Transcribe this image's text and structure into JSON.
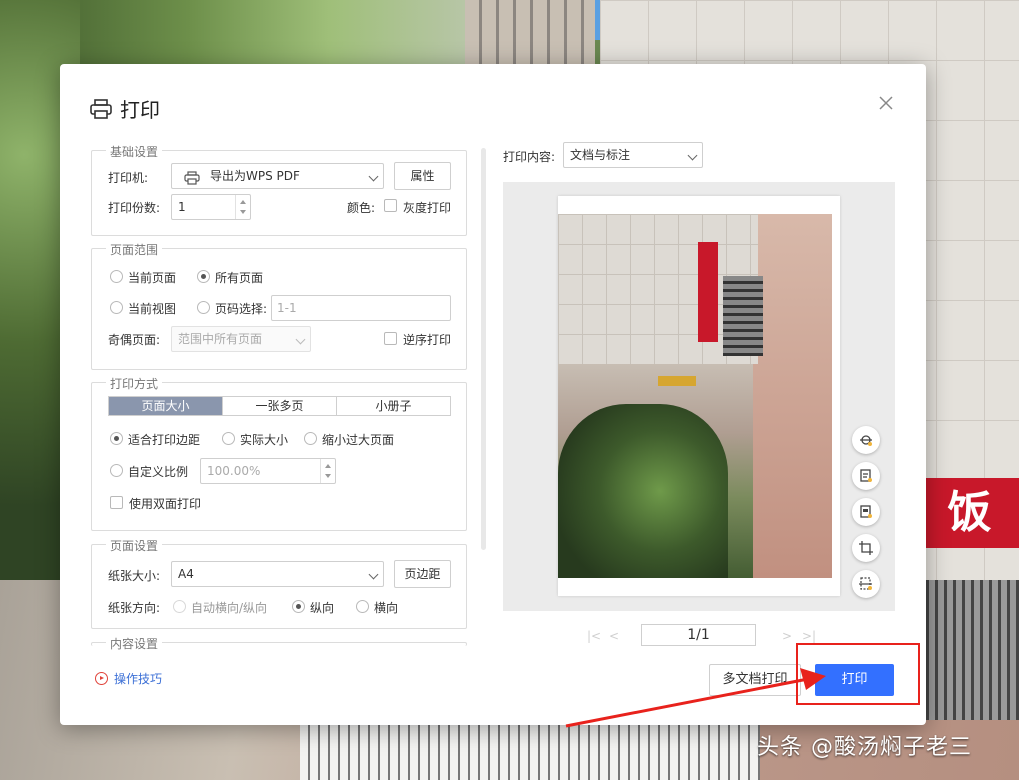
{
  "dialog": {
    "title": "打印",
    "basic": {
      "legend": "基础设置",
      "printer_label": "打印机:",
      "printer_value": "导出为WPS PDF",
      "properties_button": "属性",
      "copies_label": "打印份数:",
      "copies_value": "1",
      "color_label": "颜色:",
      "grayscale_label": "灰度打印"
    },
    "range": {
      "legend": "页面范围",
      "current_page": "当前页面",
      "all_pages": "所有页面",
      "current_view": "当前视图",
      "page_select": "页码选择:",
      "page_select_placeholder": "1-1",
      "odd_even_label": "奇偶页面:",
      "odd_even_value": "范围中所有页面",
      "reverse_label": "逆序打印"
    },
    "method": {
      "legend": "打印方式",
      "tabs": [
        "页面大小",
        "一张多页",
        "小册子"
      ],
      "fit_margin": "适合打印边距",
      "actual_size": "实际大小",
      "shrink_large": "缩小过大页面",
      "custom_scale": "自定义比例",
      "custom_scale_value": "100.00%",
      "duplex": "使用双面打印"
    },
    "page_setup": {
      "legend": "页面设置",
      "paper_size_label": "纸张大小:",
      "paper_size_value": "A4",
      "margins_button": "页边距",
      "orientation_label": "纸张方向:",
      "auto_orientation": "自动横向/纵向",
      "portrait": "纵向",
      "landscape": "横向"
    },
    "content_settings_legend": "内容设置",
    "tips_link": "操作技巧",
    "content_label": "打印内容:",
    "content_value": "文档与标注",
    "pager": "1/1",
    "multi_print_button": "多文档打印",
    "print_button": "打印"
  },
  "watermark": "头条 @酸汤焖子老三",
  "background_sign": "饭",
  "colors": {
    "primary": "#3370ff",
    "tab_active": "#8a96ad",
    "highlight": "#e8221c"
  }
}
